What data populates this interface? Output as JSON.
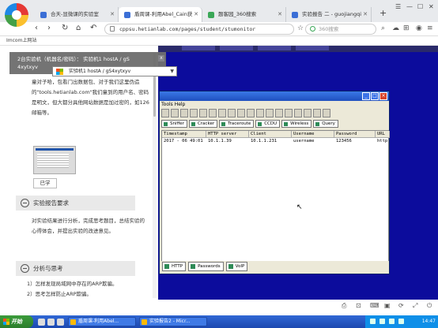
{
  "browser": {
    "tabs": [
      {
        "label": "合天-显微课的实验室",
        "active": false
      },
      {
        "label": "盾周课-利用Abel_Cain获",
        "active": true
      },
      {
        "label": "题客园_360搜索",
        "active": false
      },
      {
        "label": "实验报告 二 - guojiangqi",
        "active": false
      }
    ],
    "new_tab": "+",
    "url": "cppsu.hetianlab.com/pages/student/stumonitor",
    "search_placeholder": "360搜索",
    "bookmark": "Imcom上网站"
  },
  "remote": {
    "vm_bar_text_1": "2台实验机（机器名/密码）：",
    "vm_bar_machine": "实验机1 hostA / gS",
    "vm_bar_text_2": "4xytxyv",
    "vm_select_label": "实验机1   hostA / gS4xytxyv",
    "close_label": "x"
  },
  "doc": {
    "intro": "童对子哈，包看门出数据包、对于我们这里伪造的\"tools.hetianlab.com\"我们童到的用户名、密码是明文，但大都分具他网站数据是加过密的，如126邮箱等。",
    "thumb_caption": "已学",
    "section_report": "实验报告要求",
    "report_text": "对实验结果进行分析，完成思考题目，总结实验的心得体会，并提出实验的改进意见。",
    "section_analysis": "分析与思考",
    "analysis_items": [
      "1）怎样发现局域网中存在的ARP欺骗。",
      "2）思考怎样防止ARP欺骗。"
    ]
  },
  "app": {
    "menu": "Tools  Help",
    "nav_tabs": [
      "Sniffer",
      "Cracker",
      "Traceroute",
      "CCDU",
      "Wireless",
      "Query"
    ],
    "table_headers": [
      "Timestamp",
      "HTTP server",
      "Client",
      "Username",
      "Password",
      "URL"
    ],
    "rows": [
      [
        "2017 - 06 49:01",
        "10.1.1.39",
        "10.1.1.231",
        "username",
        "123456",
        "http"
      ]
    ],
    "bottom_tabs": [
      "HTTP",
      "Passwords",
      "VoIP"
    ]
  },
  "taskbar": {
    "start_label": "开始",
    "tasks": [
      "盾周课-利用Abel...",
      "实验报告2 - Micr..."
    ],
    "clock": "14:47"
  }
}
